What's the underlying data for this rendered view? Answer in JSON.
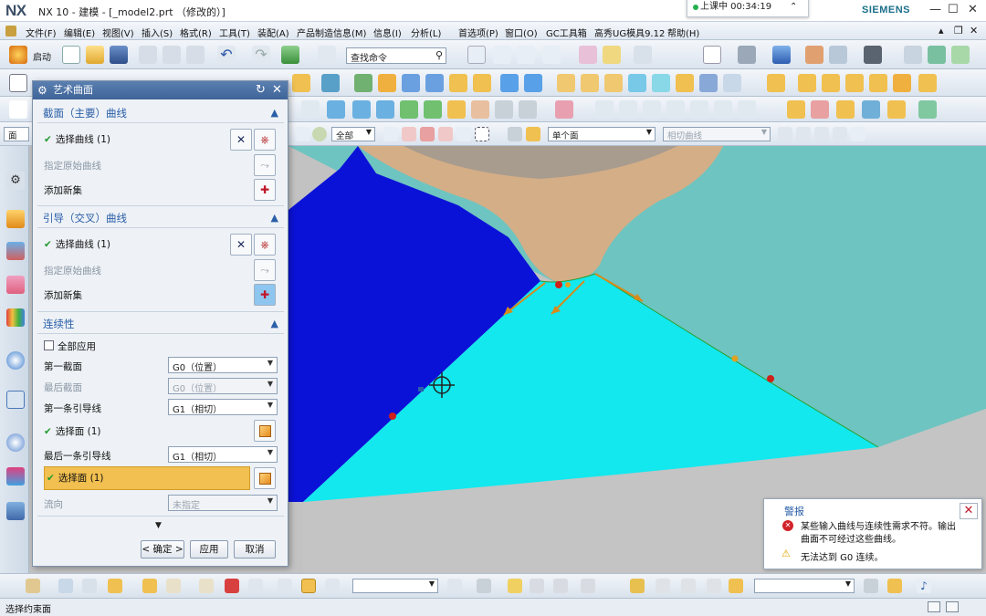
{
  "app": {
    "logo": "NX",
    "title": "NX 10 - 建模 - [_model2.prt （修改的）]",
    "brand": "SIEMENS",
    "recording_badge": "上课中 00:34:19",
    "win_minimize": "—",
    "win_restore": "☐",
    "win_close": "✕"
  },
  "menu": {
    "items": [
      "文件(F)",
      "编辑(E)",
      "视图(V)",
      "插入(S)",
      "格式(R)",
      "工具(T)",
      "装配(A)",
      "产品制造信息(M)",
      "信息(I)",
      "分析(L)",
      "首选项(P)",
      "窗口(O)",
      "GC工具箱",
      "高秀UG模具9.12",
      "帮助(H)"
    ]
  },
  "toolbar": {
    "start_label": "启动",
    "search_placeholder": "查找命令",
    "filter_all": "全部",
    "filter_face": "单个面",
    "filter_tangent": "相切曲线",
    "face_label": "面"
  },
  "dialog": {
    "title": "艺术曲面",
    "section_curves": {
      "header": "截面（主要）曲线",
      "select_curve": "选择曲线 (1)",
      "specify_origin": "指定原始曲线",
      "add_new_set": "添加新集"
    },
    "section_guides": {
      "header": "引导（交叉）曲线",
      "select_curve": "选择曲线 (1)",
      "specify_origin": "指定原始曲线",
      "add_new_set": "添加新集"
    },
    "section_continuity": {
      "header": "连续性",
      "apply_all": "全部应用",
      "first_section_label": "第一截面",
      "first_section_value": "G0（位置）",
      "last_section_label": "最后截面",
      "last_section_value": "G0（位置）",
      "first_guide_label": "第一条引导线",
      "first_guide_value": "G1（相切）",
      "select_face_1": "选择面 (1)",
      "last_guide_label": "最后一条引导线",
      "last_guide_value": "G1（相切）",
      "select_face_2": "选择面 (1)",
      "flow_label": "流向",
      "flow_value": "未指定"
    },
    "buttons": {
      "ok": "< 确定 >",
      "apply": "应用",
      "cancel": "取消"
    }
  },
  "alert": {
    "title": "警报",
    "message_error": "某些输入曲线与连续性需求不符。输出曲面不可经过这些曲线。",
    "message_warning": "无法达到 G0 连续。",
    "close_label": "✕"
  },
  "status": {
    "text": "选择约束面"
  },
  "colors": {
    "surface_cyan": "#12e8ee",
    "surface_blue": "#0b12d8",
    "surface_tan": "#d4ae87",
    "background_teal": "#6ec4c0",
    "dialog_title": "#3f6498",
    "highlight_row": "#f2c050",
    "accent": "#2a5ea8"
  }
}
